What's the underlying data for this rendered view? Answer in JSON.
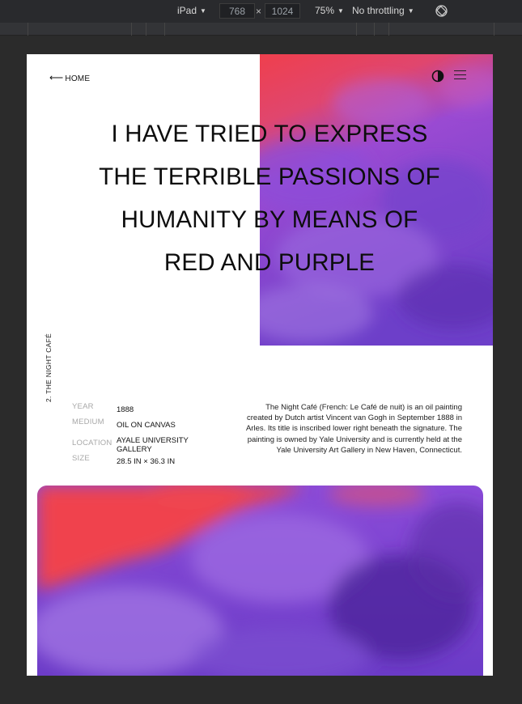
{
  "devtools": {
    "device": "iPad",
    "width": "768",
    "height": "1024",
    "times": "×",
    "zoom": "75%",
    "throttling": "No throttling"
  },
  "page": {
    "nav": {
      "home_label": "HOME",
      "back_arrow": "⟵"
    },
    "icons": {
      "theme": "contrast-icon",
      "menu": "menu-icon"
    },
    "quote": "I HAVE TRIED TO EXPRESS THE TERRIBLE PASSIONS OF HUMANITY BY MEANS OF RED AND PURPLE",
    "quote_lines": [
      "I HAVE TRIED TO EXPRESS",
      "THE TERRIBLE PASSIONS OF",
      "HUMANITY BY MEANS OF",
      "RED AND PURPLE"
    ],
    "side_label": "2. THE NIGHT CAFÉ",
    "meta": [
      {
        "key": "YEAR",
        "value": "1888"
      },
      {
        "key": "MEDIUM",
        "value": "OIL ON CANVAS"
      },
      {
        "key": "LOCATION",
        "value": "AYALE UNIVERSITY GALLERY"
      },
      {
        "key": "SIZE",
        "value": "28.5 IN × 36.3 IN"
      }
    ],
    "description": "The Night Café (French: Le Café de nuit) is an oil painting created by Dutch artist Vincent van Gogh in September 1888 in Arles. Its title is inscribed lower right beneath the signature. The painting is owned by Yale University and is currently held at the Yale University Art Gallery in New Haven, Connecticut.",
    "colors": {
      "red": "#f2414a",
      "purple": "#7c45d6",
      "deep_purple": "#4a1f8c",
      "text": "#0d0d0d"
    }
  }
}
